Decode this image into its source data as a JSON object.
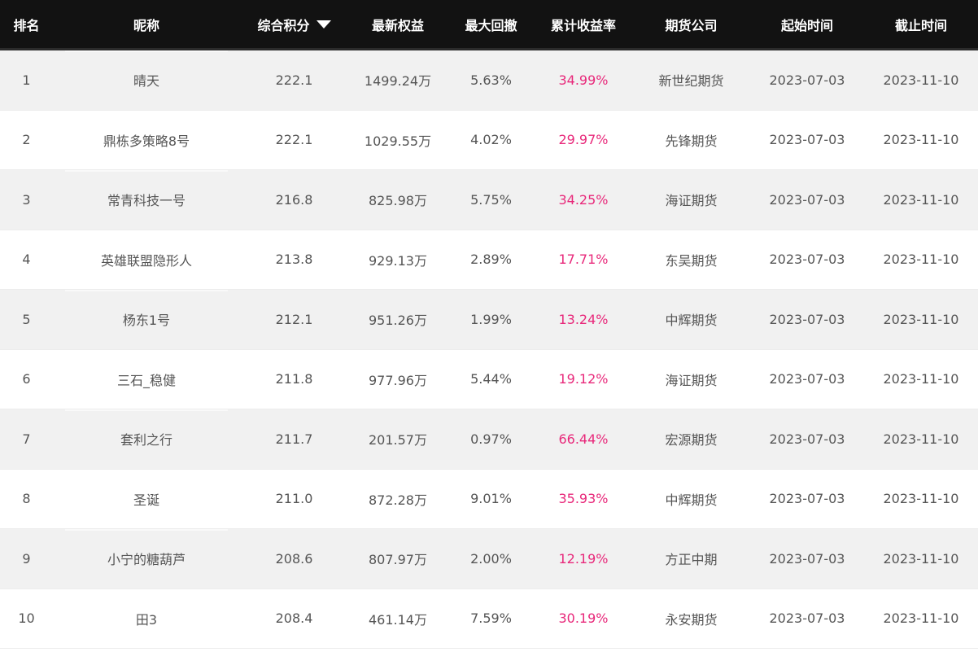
{
  "header": {
    "rank": "排名",
    "nickname": "昵称",
    "score": "综合积分",
    "equity": "最新权益",
    "drawdown": "最大回撤",
    "return": "累计收益率",
    "company": "期货公司",
    "start": "起始时间",
    "end": "截止时间"
  },
  "sort_icon": "triangle-down-icon",
  "colors": {
    "header_bg": "#121212",
    "return_text": "#e8287a",
    "odd_row": "#f1f1f1"
  },
  "rows": [
    {
      "rank": "1",
      "nickname": "晴天",
      "score": "222.1",
      "equity": "1499.24万",
      "drawdown": "5.63%",
      "return": "34.99%",
      "company": "新世纪期货",
      "start": "2023-07-03",
      "end": "2023-11-10"
    },
    {
      "rank": "2",
      "nickname": "鼎栋多策略8号",
      "score": "222.1",
      "equity": "1029.55万",
      "drawdown": "4.02%",
      "return": "29.97%",
      "company": "先锋期货",
      "start": "2023-07-03",
      "end": "2023-11-10"
    },
    {
      "rank": "3",
      "nickname": "常青科技一号",
      "score": "216.8",
      "equity": "825.98万",
      "drawdown": "5.75%",
      "return": "34.25%",
      "company": "海证期货",
      "start": "2023-07-03",
      "end": "2023-11-10"
    },
    {
      "rank": "4",
      "nickname": "英雄联盟隐形人",
      "score": "213.8",
      "equity": "929.13万",
      "drawdown": "2.89%",
      "return": "17.71%",
      "company": "东吴期货",
      "start": "2023-07-03",
      "end": "2023-11-10"
    },
    {
      "rank": "5",
      "nickname": "杨东1号",
      "score": "212.1",
      "equity": "951.26万",
      "drawdown": "1.99%",
      "return": "13.24%",
      "company": "中辉期货",
      "start": "2023-07-03",
      "end": "2023-11-10"
    },
    {
      "rank": "6",
      "nickname": "三石_稳健",
      "score": "211.8",
      "equity": "977.96万",
      "drawdown": "5.44%",
      "return": "19.12%",
      "company": "海证期货",
      "start": "2023-07-03",
      "end": "2023-11-10"
    },
    {
      "rank": "7",
      "nickname": "套利之行",
      "score": "211.7",
      "equity": "201.57万",
      "drawdown": "0.97%",
      "return": "66.44%",
      "company": "宏源期货",
      "start": "2023-07-03",
      "end": "2023-11-10"
    },
    {
      "rank": "8",
      "nickname": "圣诞",
      "score": "211.0",
      "equity": "872.28万",
      "drawdown": "9.01%",
      "return": "35.93%",
      "company": "中辉期货",
      "start": "2023-07-03",
      "end": "2023-11-10"
    },
    {
      "rank": "9",
      "nickname": "小宁的糖葫芦",
      "score": "208.6",
      "equity": "807.97万",
      "drawdown": "2.00%",
      "return": "12.19%",
      "company": "方正中期",
      "start": "2023-07-03",
      "end": "2023-11-10"
    },
    {
      "rank": "10",
      "nickname": "田3",
      "score": "208.4",
      "equity": "461.14万",
      "drawdown": "7.59%",
      "return": "30.19%",
      "company": "永安期货",
      "start": "2023-07-03",
      "end": "2023-11-10"
    }
  ]
}
